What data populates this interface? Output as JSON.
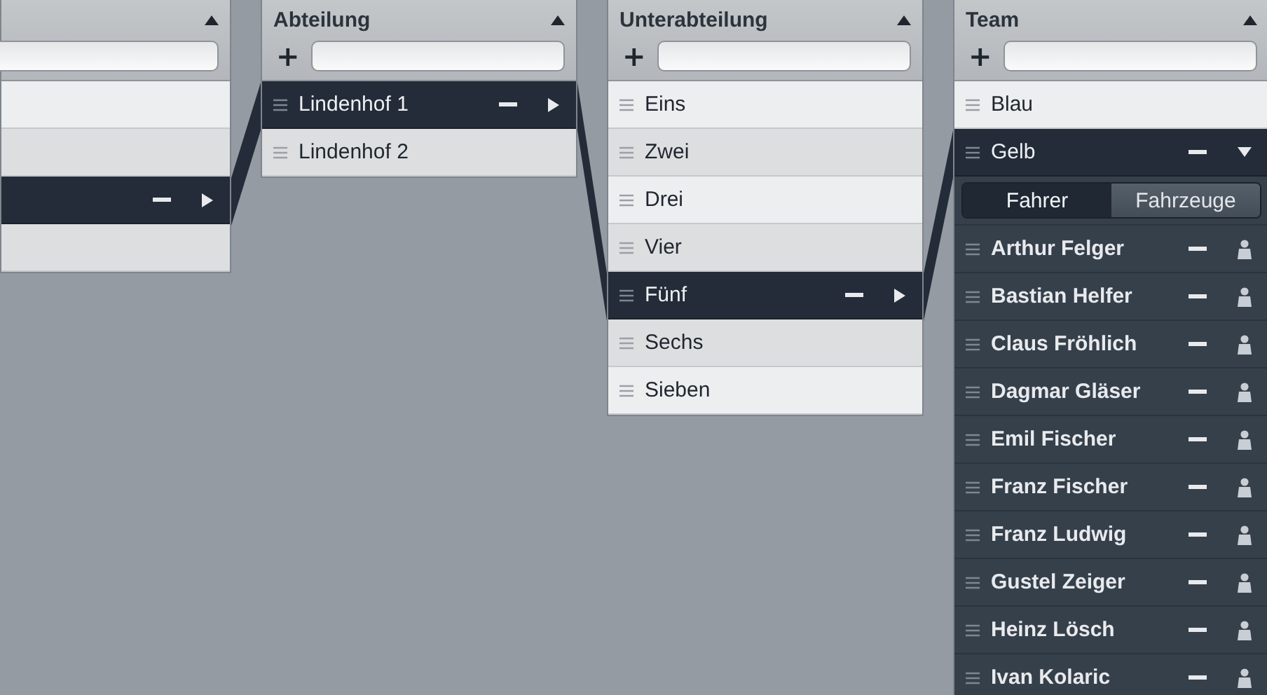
{
  "columns": [
    {
      "items": [
        {
          "selected": false
        },
        {
          "selected": false
        },
        {
          "selected": true
        },
        {
          "selected": false
        }
      ]
    },
    {
      "title": "Abteilung",
      "add_label": "+",
      "items": [
        {
          "label": "Lindenhof 1",
          "selected": true
        },
        {
          "label": "Lindenhof 2",
          "selected": false
        }
      ]
    },
    {
      "title": "Unterabteilung",
      "add_label": "+",
      "items": [
        {
          "label": "Eins",
          "selected": false
        },
        {
          "label": "Zwei",
          "selected": false
        },
        {
          "label": "Drei",
          "selected": false
        },
        {
          "label": "Vier",
          "selected": false
        },
        {
          "label": "Fünf",
          "selected": true
        },
        {
          "label": "Sechs",
          "selected": false
        },
        {
          "label": "Sieben",
          "selected": false
        }
      ]
    },
    {
      "title": "Team",
      "add_label": "+",
      "items": [
        {
          "label": "Blau",
          "selected": false
        },
        {
          "label": "Gelb",
          "selected": true,
          "expanded": true,
          "tabs": [
            {
              "label": "Fahrer",
              "selected": true
            },
            {
              "label": "Fahrzeuge",
              "selected": false
            }
          ],
          "members": [
            {
              "name": "Arthur Felger"
            },
            {
              "name": "Bastian Helfer"
            },
            {
              "name": "Claus Fröhlich"
            },
            {
              "name": "Dagmar Gläser"
            },
            {
              "name": "Emil Fischer"
            },
            {
              "name": "Franz Fischer"
            },
            {
              "name": "Franz Ludwig"
            },
            {
              "name": "Gustel Zeiger"
            },
            {
              "name": "Heinz Lösch"
            },
            {
              "name": "Ivan Kolaric"
            }
          ]
        }
      ]
    }
  ]
}
